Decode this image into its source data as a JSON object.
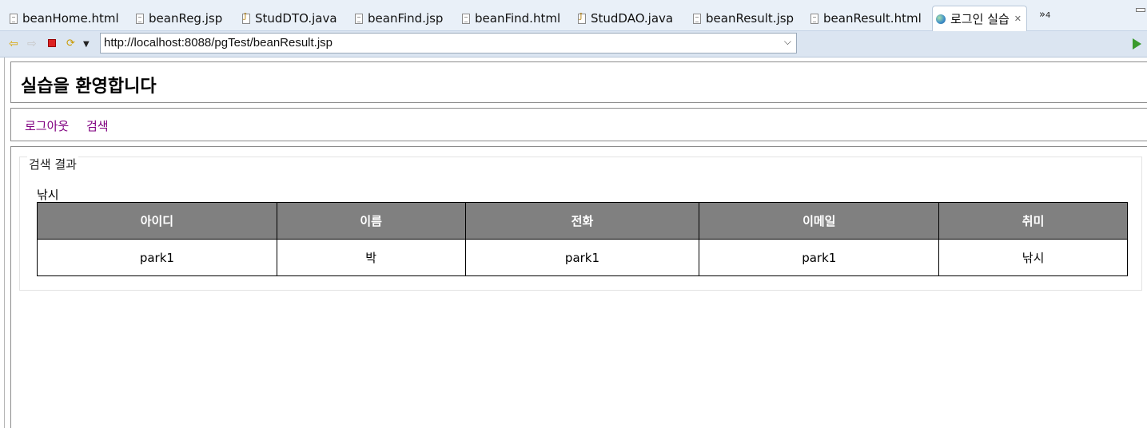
{
  "tabs": [
    {
      "label": "beanHome.html",
      "icon": "file-icon"
    },
    {
      "label": "beanReg.jsp",
      "icon": "file-icon"
    },
    {
      "label": "StudDTO.java",
      "icon": "java-file-icon"
    },
    {
      "label": "beanFind.jsp",
      "icon": "file-icon"
    },
    {
      "label": "beanFind.html",
      "icon": "file-icon"
    },
    {
      "label": "StudDAO.java",
      "icon": "java-file-icon"
    },
    {
      "label": "beanResult.jsp",
      "icon": "file-icon"
    },
    {
      "label": "beanResult.html",
      "icon": "file-icon"
    },
    {
      "label": "로그인 실습",
      "icon": "globe-icon",
      "active": true
    }
  ],
  "overflow_tabs": {
    "symbol": "»",
    "count": "4"
  },
  "address": {
    "url": "http://localhost:8088/pgTest/beanResult.jsp"
  },
  "page": {
    "title": "실습을 환영합니다",
    "menu": {
      "logout": "로그아웃",
      "search": "검색"
    },
    "results": {
      "legend": "검색 결과",
      "hobby_line": "낚시",
      "columns": [
        "아이디",
        "이름",
        "전화",
        "이메일",
        "취미"
      ],
      "rows": [
        [
          "park1",
          "박",
          "park1",
          "park1",
          "낚시"
        ]
      ]
    }
  },
  "colors": {
    "header_bg": "#808080",
    "link": "#800080",
    "tabbar_bg": "#e9f0f8"
  }
}
